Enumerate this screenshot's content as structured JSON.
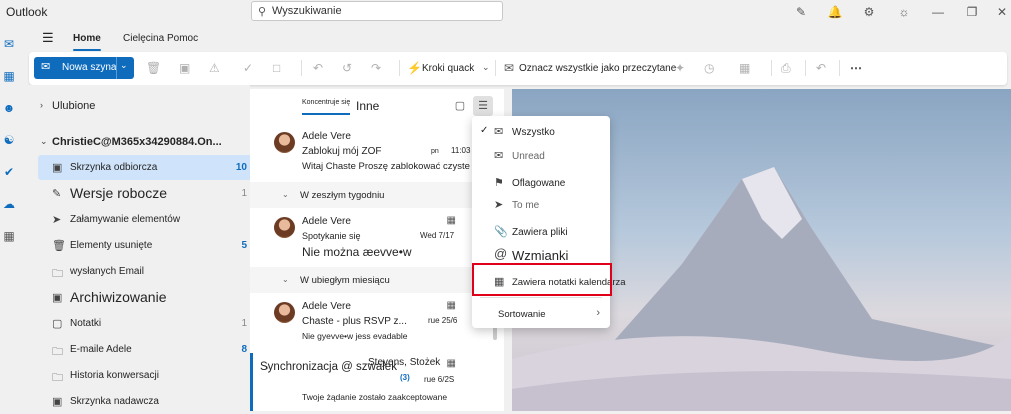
{
  "app": {
    "title": "Outlook"
  },
  "search": {
    "placeholder": "Wyszukiwanie"
  },
  "ribbon": {
    "tabs": [
      "Home",
      "Cielęcina",
      "Pomoc"
    ],
    "new_mail": "Nowa szyna",
    "quick_steps": "Kroki quack",
    "mark_all_read": "Oznacz wszystkie jako przeczytane"
  },
  "folders": {
    "favorites": "Ulubione",
    "account": "ChristieC@M365x34290884.On...",
    "items": [
      {
        "label": "Skrzynka odbiorcza",
        "count": "10",
        "icon": "inbox-icon"
      },
      {
        "label": "Wersje robocze",
        "count": "1",
        "icon": "draft-icon"
      },
      {
        "label": "Załamywanie elementów",
        "count": "",
        "icon": "send-icon"
      },
      {
        "label": "Elementy usunięte",
        "count": "5",
        "icon": "trash-icon"
      },
      {
        "label": "wysłanych Email",
        "count": "",
        "icon": "folder-icon"
      },
      {
        "label": "Archiwizowanie",
        "count": "",
        "icon": "archive-icon"
      },
      {
        "label": "Notatki",
        "count": "1",
        "icon": "note-icon"
      },
      {
        "label": "E-maile Adele",
        "count": "8",
        "icon": "folder-icon"
      },
      {
        "label": "Historia konwersacji",
        "count": "",
        "icon": "folder-icon"
      },
      {
        "label": "Skrzynka nadawcza",
        "count": "",
        "icon": "outbox-icon"
      }
    ]
  },
  "list": {
    "tab_focused": "Koncentruje się",
    "tab_other": "Inne",
    "groups": [
      "W zeszłym tygodniu",
      "W ubiegłym miesiącu"
    ],
    "messages": [
      {
        "sender": "Adele Vere",
        "subject": "Zablokuj mój ZOF",
        "day": "pn",
        "time": "11:03 PM",
        "preview": "Witaj Chaste Proszę zablokować czyste"
      },
      {
        "sender": "Adele Vere",
        "subject": "Spotykanie się",
        "date": "Wed 7/17",
        "preview": "Nie można æevve•w"
      },
      {
        "sender": "Adele Vere",
        "subject": "Chaste - plus RSVP z...",
        "date": "rue 25/6",
        "preview": "Nie gyevve•w jess evadable"
      },
      {
        "sender": "Synchronizacja @ szwałek",
        "sender_overlay": "Stevens, Stożek",
        "count": "(3)",
        "date": "rue 6/2S",
        "preview": "Twoje żądanie zostało zaakceptowane"
      }
    ]
  },
  "filter_menu": {
    "items": [
      {
        "label": "Wszystko",
        "icon": "mail-icon",
        "checked": true
      },
      {
        "label": "Unread",
        "icon": "unread-icon"
      },
      {
        "label": "Oflagowane",
        "icon": "flag-icon"
      },
      {
        "label": "To me",
        "icon": "send-icon"
      },
      {
        "label": "Zawiera pliki",
        "icon": "paperclip-icon"
      },
      {
        "label": "Wzmianki",
        "icon": "at-icon"
      },
      {
        "label": "Zawiera notatki kalendarza",
        "icon": "calendar-icon"
      }
    ],
    "sort_label": "Sortowanie"
  }
}
